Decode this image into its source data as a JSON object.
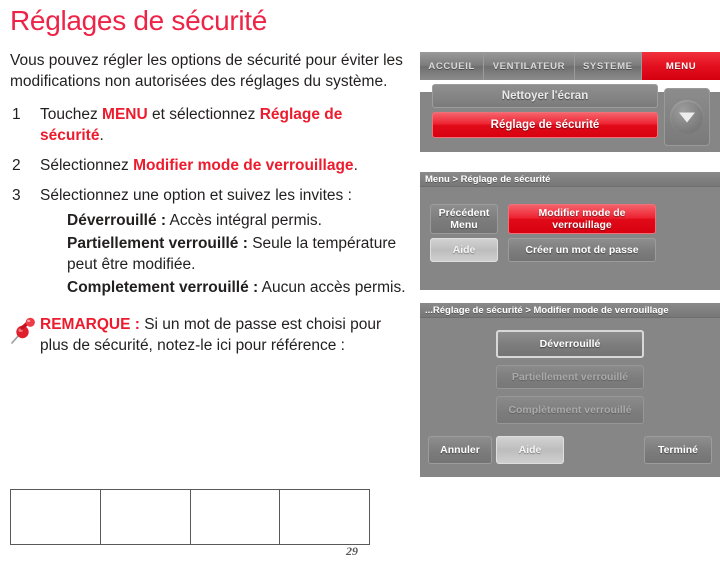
{
  "page": {
    "title": "Réglages de sécurité",
    "number": "29",
    "accent_red": "#ed2447",
    "body_red": "#ec1c2e"
  },
  "intro": "Vous pouvez régler les options de sécurité pour éviter les modifications non autorisées des réglages du système.",
  "steps": [
    {
      "num": "1",
      "before": "Touchez ",
      "bold1": "MENU",
      "middle": " et sélectionnez ",
      "bold2": "Réglage de sécurité",
      "after": "."
    },
    {
      "num": "2",
      "before": "Sélectionnez ",
      "bold1": "Modifier mode de verrouillage",
      "middle": "",
      "bold2": "",
      "after": "."
    },
    {
      "num": "3",
      "before": "Sélectionnez une option et suivez les invites :",
      "bold1": "",
      "middle": "",
      "bold2": "",
      "after": ""
    }
  ],
  "options": [
    {
      "label": "Déverrouillé :",
      "desc": " Accès intégral permis."
    },
    {
      "label": "Partiellement verrouillé :",
      "desc": " Seule la température peut être modifiée."
    },
    {
      "label": "Completement verrouillé :",
      "desc": " Aucun accès permis."
    }
  ],
  "remark": {
    "icon": "push-pin-icon",
    "label": "REMARQUE :",
    "text": " Si un mot de passe est choisi pour plus de sécurité, notez-le ici pour référence :"
  },
  "write_table": {
    "rows": 1,
    "columns": 4,
    "cells": [
      "",
      "",
      "",
      ""
    ]
  },
  "screens": [
    {
      "id": "screen-1",
      "name": "menu-screen",
      "tabs": [
        {
          "label": "ACCUEIL",
          "active": false
        },
        {
          "label": "VENTILATEUR",
          "active": false
        },
        {
          "label": "SYSTEME",
          "active": false
        },
        {
          "label": "MENU",
          "active": true
        }
      ],
      "list_items": [
        {
          "label": "Nettoyer l'écran",
          "state": "normal"
        },
        {
          "label": "Réglage de sécurité",
          "state": "highlighted"
        }
      ],
      "scroll_icon": "chevron-down-icon"
    },
    {
      "id": "screen-2",
      "name": "security-settings-screen",
      "breadcrumb": "Menu > Réglage de sécurité",
      "buttons": [
        {
          "label": "Précédent Menu",
          "state": "normal"
        },
        {
          "label": "Modifier mode de verrouillage",
          "state": "highlighted"
        },
        {
          "label": "Aide",
          "state": "light"
        },
        {
          "label": "Créer un mot de passe",
          "state": "normal"
        }
      ]
    },
    {
      "id": "screen-3",
      "name": "lock-mode-screen",
      "breadcrumb": "...Réglage de sécurité > Modifier mode de verrouillage",
      "buttons": [
        {
          "label": "Déverrouillé",
          "state": "selected"
        },
        {
          "label": "Partiellement verrouillé",
          "state": "dim"
        },
        {
          "label": "Complètement verrouillé",
          "state": "dim"
        },
        {
          "label": "Annuler",
          "state": "normal"
        },
        {
          "label": "Aide",
          "state": "light"
        },
        {
          "label": "Terminé",
          "state": "normal"
        }
      ]
    }
  ]
}
